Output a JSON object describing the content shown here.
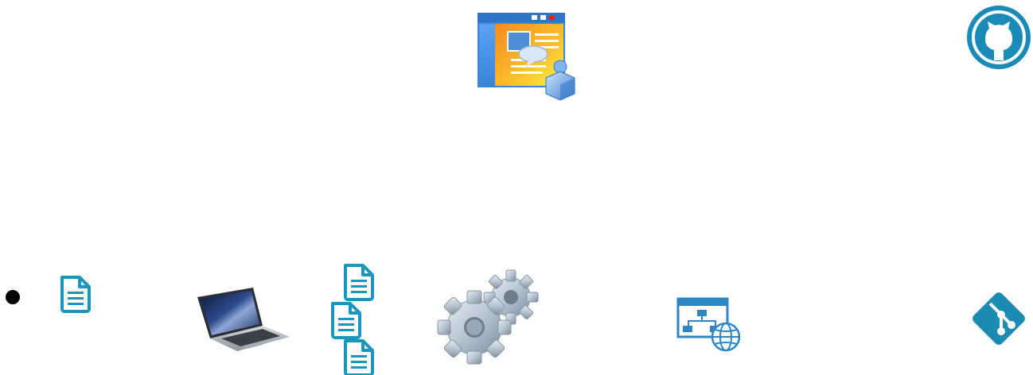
{
  "diagram": {
    "nodes": [
      {
        "id": "bullet",
        "icon": "bullet-dot-icon"
      },
      {
        "id": "doc-single",
        "icon": "document-icon"
      },
      {
        "id": "laptop",
        "icon": "laptop-icon"
      },
      {
        "id": "doc-stack",
        "icon": "document-stack-icon"
      },
      {
        "id": "gears",
        "icon": "gears-icon"
      },
      {
        "id": "web-app",
        "icon": "web-application-user-icon"
      },
      {
        "id": "sitemap",
        "icon": "website-sitemap-icon"
      },
      {
        "id": "github",
        "icon": "github-icon"
      },
      {
        "id": "git",
        "icon": "git-icon"
      }
    ]
  },
  "colors": {
    "doc_teal": "#1a96bd",
    "github_teal": "#1a8bb8",
    "git_teal": "#1b8bb2",
    "sitemap_blue": "#2f86c4",
    "gear_grey": "#b9c6d2",
    "window_orange": "#f7a31c",
    "window_yellow": "#fff34a",
    "window_blue": "#3b8fe0"
  }
}
